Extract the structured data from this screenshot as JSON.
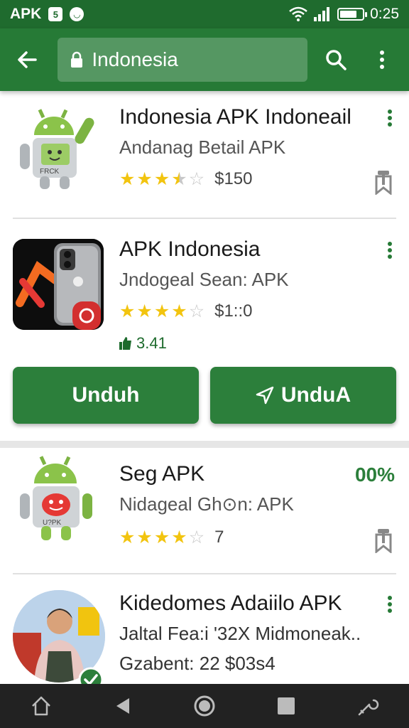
{
  "status_bar": {
    "app_label": "APK",
    "notification_icon_1": "5",
    "time": "0:25",
    "battery_level": 0.8
  },
  "app_bar": {
    "search_value": "Indonesia"
  },
  "items": [
    {
      "title": "Indonesia APK Indoneail",
      "subtitle": "Andanag Betail APK",
      "rating": 3.5,
      "price": "$150"
    },
    {
      "title": "APK Indonesia",
      "subtitle": "Jndogeal Sean: APK",
      "rating": 4,
      "price": "$1::0",
      "likes": "3.41",
      "buttons": {
        "primary": "Unduh",
        "secondary": "UnduA"
      }
    },
    {
      "title": "Seg APK",
      "subtitle": "Nidageal Gh⊙n: APK",
      "rating": 4,
      "price": "7",
      "percent": "00%"
    },
    {
      "title": "Kidedomes Adaiilo APK",
      "subtitle": "Jaltal Fea:i '32X Midmoneak..",
      "subtitle2": "Gzabent: 22 $03s4"
    }
  ],
  "icons": {
    "back": "arrow-left-icon",
    "lock": "lock-icon",
    "search": "search-icon",
    "more": "more-vert-icon",
    "bookmark": "bookmark-icon",
    "thumb": "thumbs-up-icon",
    "send": "send-icon",
    "home": "home-icon",
    "back_nav": "back-triangle-icon",
    "circle": "home-circle-icon",
    "square": "recents-square-icon",
    "tool": "tool-icon"
  },
  "colors": {
    "primary": "#267a36",
    "status": "#1f6b2e",
    "star": "#f2c40f"
  }
}
